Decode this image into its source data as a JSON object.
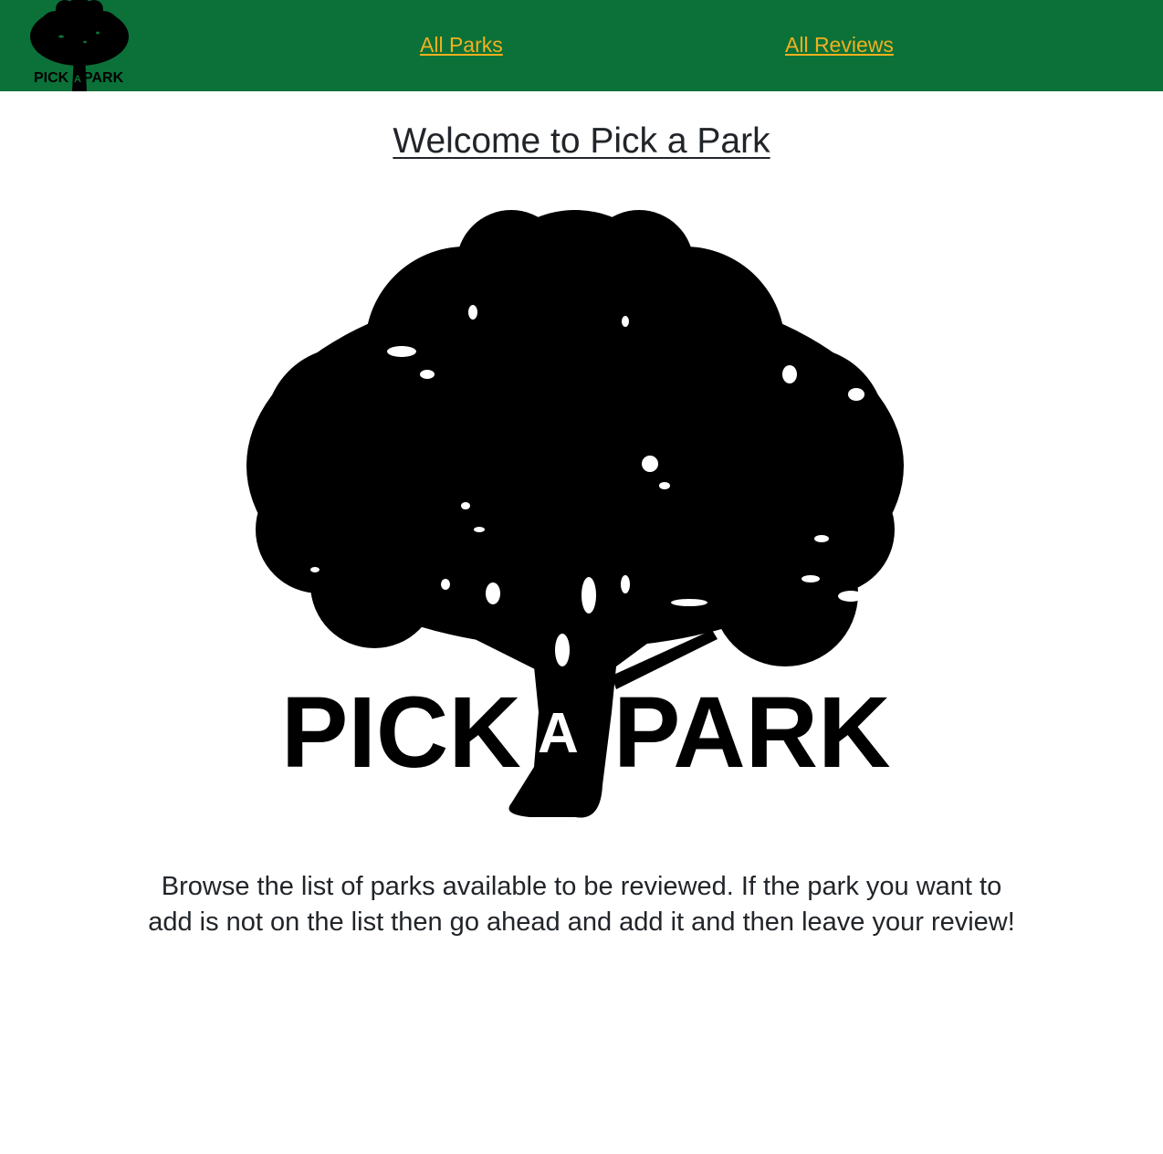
{
  "nav": {
    "logo": {
      "icon": "pick-a-park-tree-logo",
      "text_left": "PICK",
      "text_mid": "A",
      "text_right": "PARK"
    },
    "links": [
      {
        "label": "All Parks"
      },
      {
        "label": "All Reviews"
      }
    ]
  },
  "main": {
    "title": "Welcome to Pick a Park",
    "hero_logo": {
      "icon": "pick-a-park-tree-logo",
      "text_left": "PICK",
      "text_mid": "A",
      "text_right": "PARK"
    },
    "intro": "Browse the list of parks available to be reviewed. If the park you want to add is not on the list then go ahead and add it and then leave your review!"
  },
  "colors": {
    "navbar_bg": "#0b7138",
    "link": "#f2b01e",
    "text": "#212529",
    "logo": "#000000"
  }
}
